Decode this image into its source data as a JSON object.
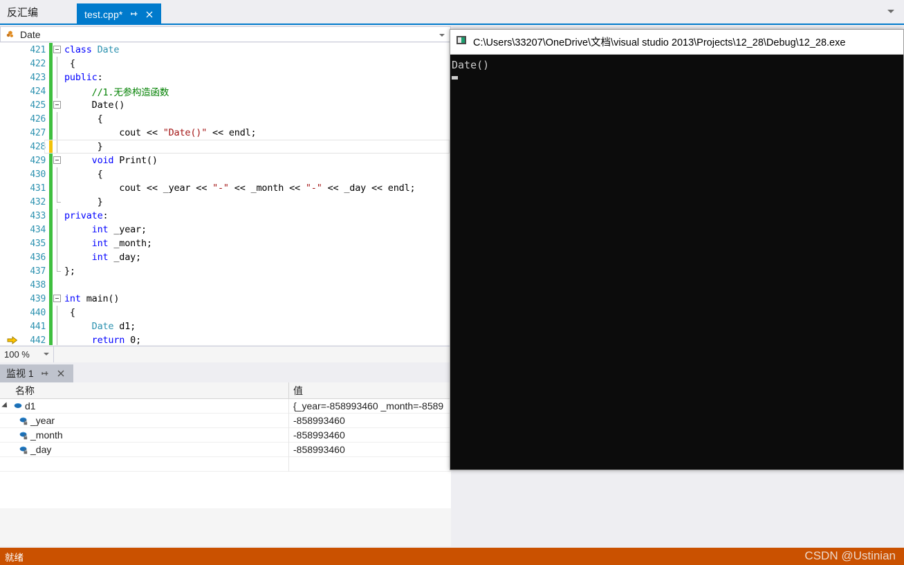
{
  "tabstrip": {
    "inactive_tab_label": "反汇编",
    "active_tab_label": "test.cpp*",
    "pin_icon": "pin-icon",
    "close_icon": "close-icon",
    "overflow_icon": "chevron-down-icon"
  },
  "navbar": {
    "icon": "class-icon",
    "label": "Date"
  },
  "editor": {
    "zoom_level": "100 %",
    "lines": [
      {
        "num": "421",
        "change": "green",
        "fold": "open",
        "exec": false,
        "current": false,
        "tokens": [
          {
            "t": "class ",
            "c": "kw"
          },
          {
            "t": "Date",
            "c": "typ"
          }
        ]
      },
      {
        "num": "422",
        "change": "green",
        "fold": "line",
        "exec": false,
        "current": false,
        "tokens": [
          {
            "t": " {",
            "c": ""
          }
        ]
      },
      {
        "num": "423",
        "change": "green",
        "fold": "line",
        "exec": false,
        "current": false,
        "tokens": [
          {
            "t": "public",
            "c": "kw"
          },
          {
            "t": ":",
            "c": ""
          }
        ]
      },
      {
        "num": "424",
        "change": "green",
        "fold": "line",
        "exec": false,
        "current": false,
        "tokens": [
          {
            "t": "     //1.无参构造函数",
            "c": "cmt"
          }
        ]
      },
      {
        "num": "425",
        "change": "green",
        "fold": "open",
        "exec": false,
        "current": false,
        "tokens": [
          {
            "t": "     Date()",
            "c": ""
          }
        ]
      },
      {
        "num": "426",
        "change": "green",
        "fold": "line",
        "exec": false,
        "current": false,
        "tokens": [
          {
            "t": "      {",
            "c": ""
          }
        ]
      },
      {
        "num": "427",
        "change": "green",
        "fold": "line",
        "exec": false,
        "current": false,
        "tokens": [
          {
            "t": "          cout << ",
            "c": ""
          },
          {
            "t": "\"Date()\"",
            "c": "str"
          },
          {
            "t": " << endl;",
            "c": ""
          }
        ]
      },
      {
        "num": "428",
        "change": "yellow",
        "fold": "line",
        "exec": false,
        "current": true,
        "tokens": [
          {
            "t": "      }",
            "c": ""
          }
        ]
      },
      {
        "num": "429",
        "change": "green",
        "fold": "open",
        "exec": false,
        "current": false,
        "tokens": [
          {
            "t": "     void",
            "c": "kw"
          },
          {
            "t": " Print()",
            "c": ""
          }
        ]
      },
      {
        "num": "430",
        "change": "green",
        "fold": "line",
        "exec": false,
        "current": false,
        "tokens": [
          {
            "t": "      {",
            "c": ""
          }
        ]
      },
      {
        "num": "431",
        "change": "green",
        "fold": "line",
        "exec": false,
        "current": false,
        "tokens": [
          {
            "t": "          cout << _year << ",
            "c": ""
          },
          {
            "t": "\"-\"",
            "c": "str"
          },
          {
            "t": " << _month << ",
            "c": ""
          },
          {
            "t": "\"-\"",
            "c": "str"
          },
          {
            "t": " << _day << endl;",
            "c": ""
          }
        ]
      },
      {
        "num": "432",
        "change": "green",
        "fold": "end",
        "exec": false,
        "current": false,
        "tokens": [
          {
            "t": "      }",
            "c": ""
          }
        ]
      },
      {
        "num": "433",
        "change": "green",
        "fold": "line",
        "exec": false,
        "current": false,
        "tokens": [
          {
            "t": "private",
            "c": "kw"
          },
          {
            "t": ":",
            "c": ""
          }
        ]
      },
      {
        "num": "434",
        "change": "green",
        "fold": "line",
        "exec": false,
        "current": false,
        "tokens": [
          {
            "t": "     int",
            "c": "kw"
          },
          {
            "t": " _year;",
            "c": ""
          }
        ]
      },
      {
        "num": "435",
        "change": "green",
        "fold": "line",
        "exec": false,
        "current": false,
        "tokens": [
          {
            "t": "     int",
            "c": "kw"
          },
          {
            "t": " _month;",
            "c": ""
          }
        ]
      },
      {
        "num": "436",
        "change": "green",
        "fold": "line",
        "exec": false,
        "current": false,
        "tokens": [
          {
            "t": "     int",
            "c": "kw"
          },
          {
            "t": " _day;",
            "c": ""
          }
        ]
      },
      {
        "num": "437",
        "change": "green",
        "fold": "end",
        "exec": false,
        "current": false,
        "tokens": [
          {
            "t": "};",
            "c": ""
          }
        ]
      },
      {
        "num": "438",
        "change": "green",
        "fold": "none",
        "exec": false,
        "current": false,
        "tokens": [
          {
            "t": "",
            "c": ""
          }
        ]
      },
      {
        "num": "439",
        "change": "green",
        "fold": "open",
        "exec": false,
        "current": false,
        "tokens": [
          {
            "t": "int",
            "c": "kw"
          },
          {
            "t": " main()",
            "c": ""
          }
        ]
      },
      {
        "num": "440",
        "change": "green",
        "fold": "line",
        "exec": false,
        "current": false,
        "tokens": [
          {
            "t": " {",
            "c": ""
          }
        ]
      },
      {
        "num": "441",
        "change": "green",
        "fold": "line",
        "exec": false,
        "current": false,
        "tokens": [
          {
            "t": "     ",
            "c": ""
          },
          {
            "t": "Date",
            "c": "typ"
          },
          {
            "t": " d1;",
            "c": ""
          }
        ]
      },
      {
        "num": "442",
        "change": "green",
        "fold": "line",
        "exec": true,
        "current": false,
        "tokens": [
          {
            "t": "     return",
            "c": "kw"
          },
          {
            "t": " 0;",
            "c": ""
          }
        ]
      }
    ]
  },
  "watch": {
    "tab_label": "监视 1",
    "pin_icon": "pin-icon",
    "close_icon": "close-icon",
    "columns": [
      "名称",
      "值"
    ],
    "rows": [
      {
        "name": "d1",
        "value": "{_year=-858993460 _month=-8589",
        "level": 0,
        "expandable": true,
        "icon": "object-icon"
      },
      {
        "name": "_year",
        "value": "-858993460",
        "level": 1,
        "expandable": false,
        "icon": "private-field-icon"
      },
      {
        "name": "_month",
        "value": "-858993460",
        "level": 1,
        "expandable": false,
        "icon": "private-field-icon"
      },
      {
        "name": "_day",
        "value": "-858993460",
        "level": 1,
        "expandable": false,
        "icon": "private-field-icon"
      }
    ]
  },
  "statusbar": {
    "text": "就绪",
    "color": "#ca5100"
  },
  "console": {
    "icon": "console-app-icon",
    "title": "C:\\Users\\33207\\OneDrive\\文档\\visual studio 2013\\Projects\\12_28\\Debug\\12_28.exe",
    "output": "Date()"
  },
  "watermark": {
    "text": "CSDN @Ustinian"
  }
}
